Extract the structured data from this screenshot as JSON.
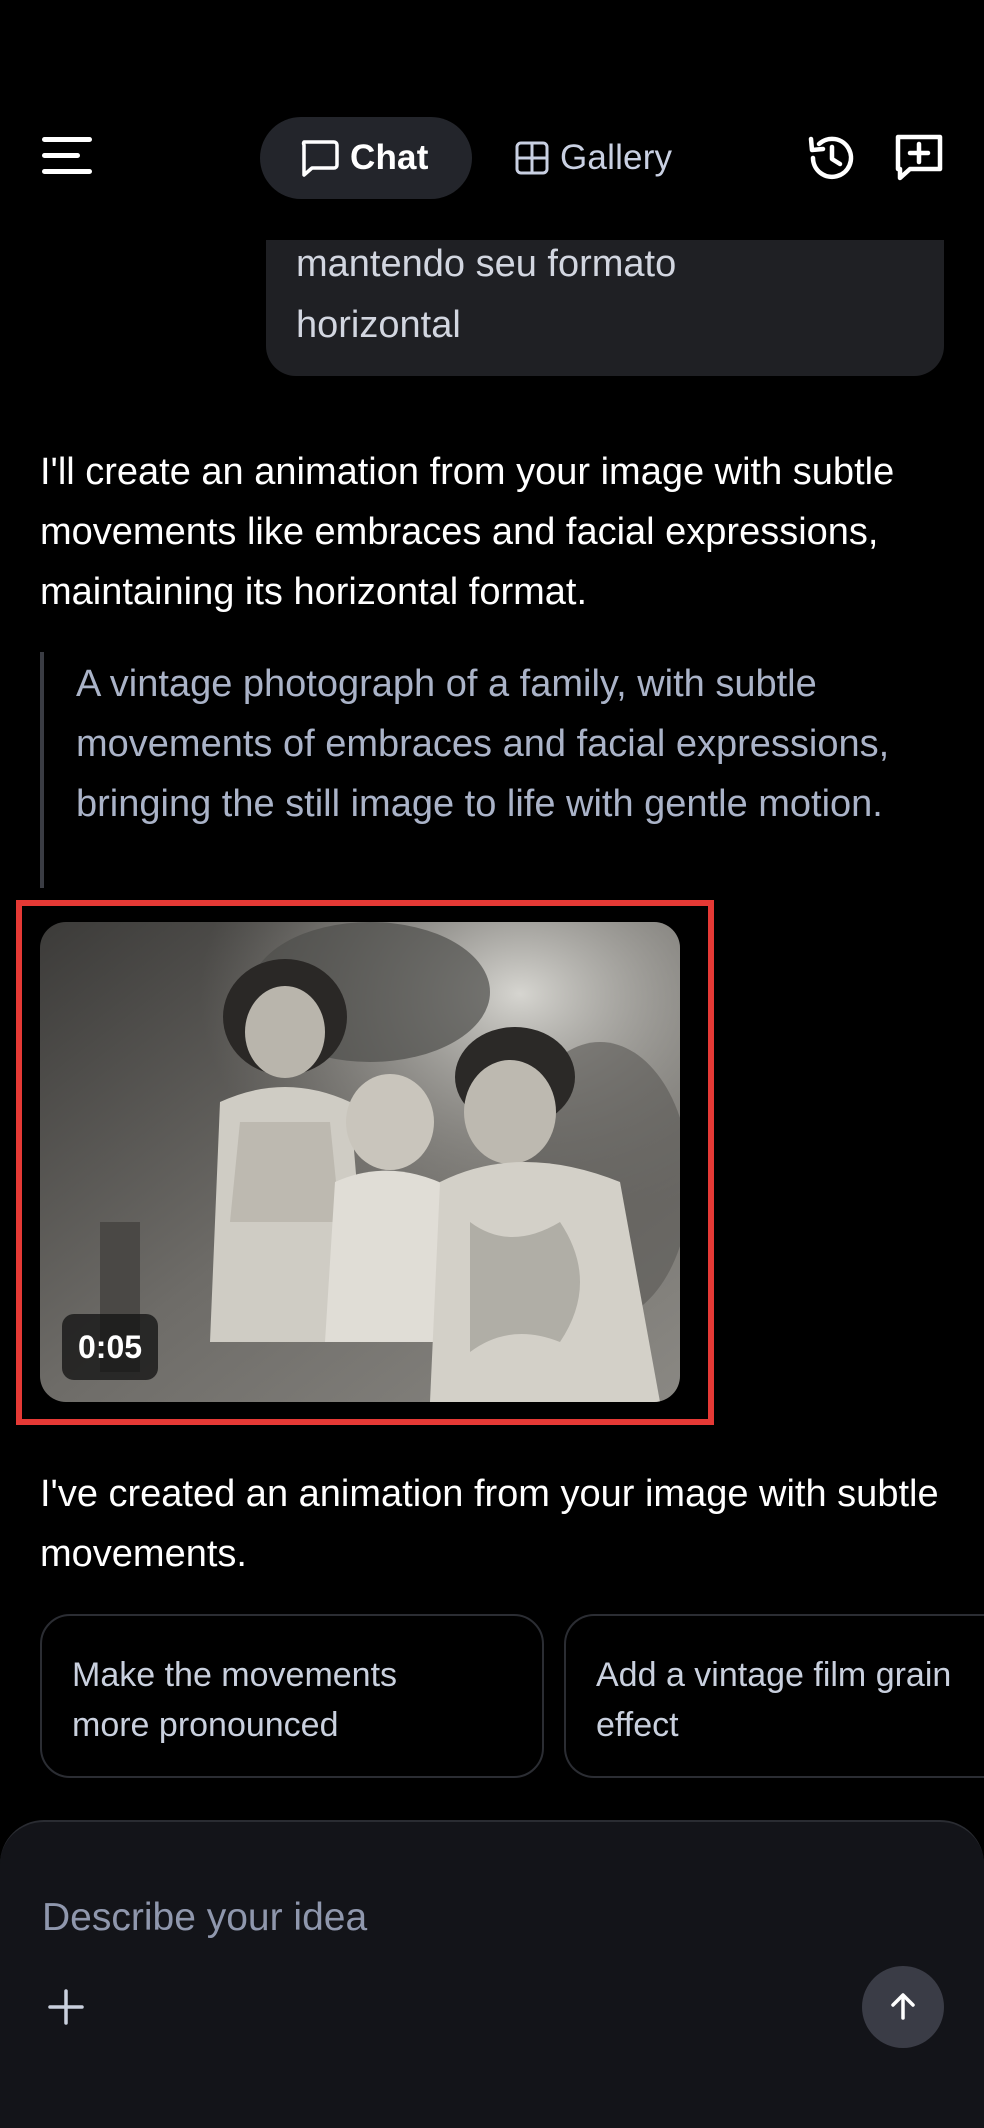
{
  "header": {
    "menu_icon": "hamburger-menu-icon",
    "tabs": [
      {
        "label": "Chat",
        "icon": "chat-bubble-icon",
        "active": true
      },
      {
        "label": "Gallery",
        "icon": "grid-icon",
        "active": false
      }
    ],
    "actions": [
      "history-icon",
      "new-chat-icon"
    ]
  },
  "conversation": {
    "user_message_visible": "mantendo seu formato\nhorizontal",
    "assistant_intro": "I'll create an animation from your image with subtle movements like embraces and facial expressions, maintaining its horizontal format.",
    "prompt_quote": "A vintage photograph of a family, with subtle movements of embraces and facial expressions, bringing the still image to life with gentle motion.",
    "video": {
      "duration": "0:05"
    },
    "assistant_followup": "I've created an animation from your image with subtle movements."
  },
  "suggestions": [
    {
      "label": "Make the movements\nmore pronounced"
    },
    {
      "label": "Add a vintage film grain\neffect"
    }
  ],
  "composer": {
    "placeholder": "Describe your idea",
    "plus_icon": "plus-icon",
    "send_icon": "arrow-up-icon"
  },
  "colors": {
    "background": "#000000",
    "surface": "#1f2024",
    "highlight_frame": "#e53935",
    "muted_text": "#aab3c8"
  }
}
